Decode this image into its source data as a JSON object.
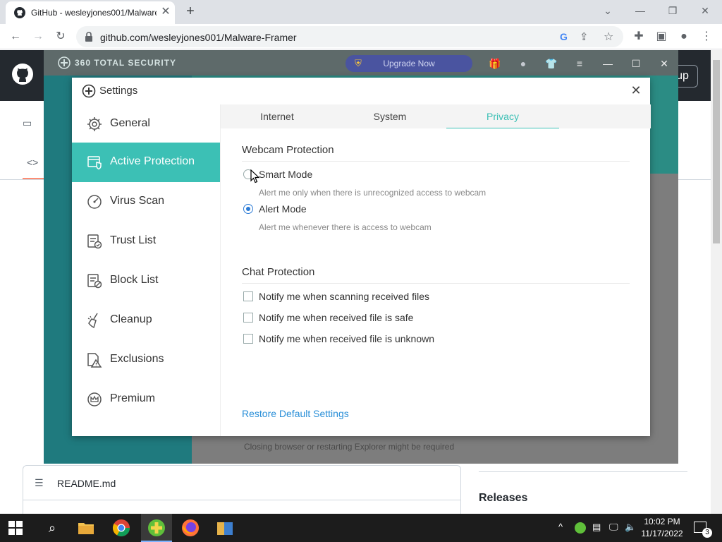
{
  "browser": {
    "tab_title": "GitHub - wesleyjones001/Malware-Framer",
    "url": "github.com/wesleyjones001/Malware-Framer"
  },
  "github": {
    "signup_label": "up",
    "readme_label": "README.md",
    "releases_label": "Releases"
  },
  "ts": {
    "brand": "360 TOTAL SECURITY",
    "upgrade_label": "Upgrade Now",
    "note": "Closing browser or restarting Explorer might be required"
  },
  "settings": {
    "title": "Settings",
    "nav": [
      {
        "label": "General",
        "icon": "gear-icon",
        "active": false
      },
      {
        "label": "Active Protection",
        "icon": "shield-icon",
        "active": true
      },
      {
        "label": "Virus Scan",
        "icon": "scan-icon",
        "active": false
      },
      {
        "label": "Trust List",
        "icon": "trust-list-icon",
        "active": false
      },
      {
        "label": "Block List",
        "icon": "block-list-icon",
        "active": false
      },
      {
        "label": "Cleanup",
        "icon": "broom-icon",
        "active": false
      },
      {
        "label": "Exclusions",
        "icon": "exclusion-icon",
        "active": false
      },
      {
        "label": "Premium",
        "icon": "crown-icon",
        "active": false
      }
    ],
    "tabs": [
      {
        "label": "Internet",
        "selected": false
      },
      {
        "label": "System",
        "selected": false
      },
      {
        "label": "Privacy",
        "selected": true
      }
    ],
    "webcam": {
      "title": "Webcam Protection",
      "smart_label": "Smart Mode",
      "smart_hint": "Alert me only when there is unrecognized access to webcam",
      "alert_label": "Alert Mode",
      "alert_hint": "Alert me whenever there is access to webcam",
      "selected": "alert"
    },
    "chat": {
      "title": "Chat Protection",
      "options": [
        {
          "label": "Notify me when scanning received files",
          "checked": false
        },
        {
          "label": "Notify me when received file is safe",
          "checked": false
        },
        {
          "label": "Notify me when received file is unknown",
          "checked": false
        }
      ]
    },
    "restore_label": "Restore Default Settings"
  },
  "taskbar": {
    "time": "10:02 PM",
    "date": "11/17/2022",
    "notification_count": "3"
  },
  "colors": {
    "accent_teal": "#3cc0b5",
    "link_blue": "#2a8fd8",
    "radio_blue": "#2b7bd6"
  }
}
